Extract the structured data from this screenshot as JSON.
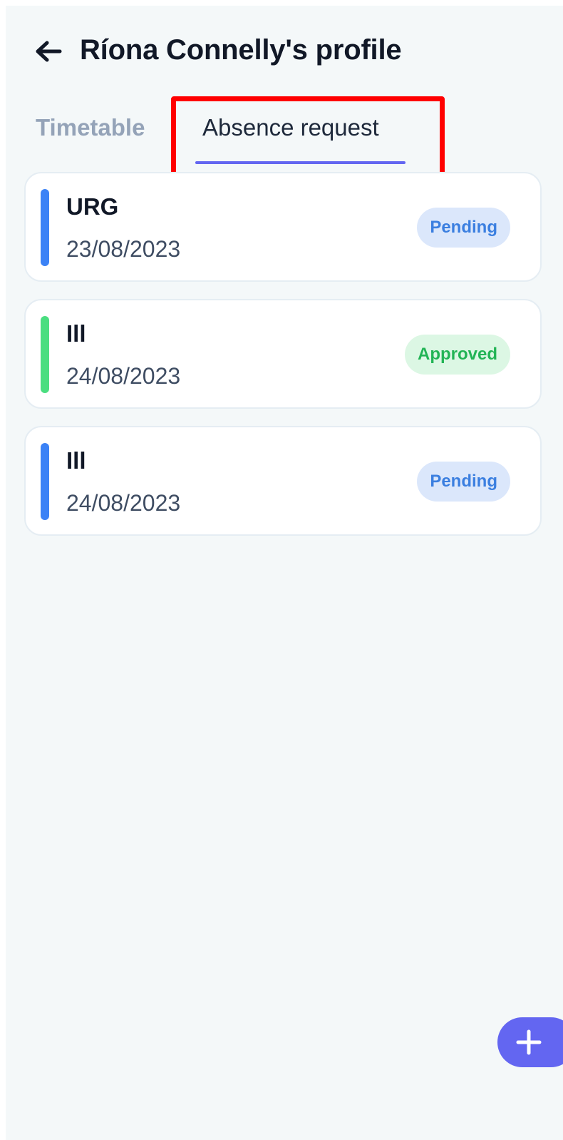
{
  "header": {
    "title": "Ríona Connelly's profile",
    "back_icon": "arrow-left-icon"
  },
  "tabs": [
    {
      "label": "Timetable",
      "active": false
    },
    {
      "label": "Absence request",
      "active": true
    }
  ],
  "colors": {
    "accent": "#6366f1",
    "highlight": "#ff0000",
    "pending_bar": "#3b82f6",
    "pending_badge_bg": "#dbe7fb",
    "pending_badge_text": "#3b7fe0",
    "approved_bar": "#4ade80",
    "approved_badge_bg": "#dcf7e4",
    "approved_badge_text": "#22b455"
  },
  "requests": [
    {
      "title": "URG",
      "date": "23/08/2023",
      "status": "Pending"
    },
    {
      "title": "Ill",
      "date": "24/08/2023",
      "status": "Approved"
    },
    {
      "title": "Ill",
      "date": "24/08/2023",
      "status": "Pending"
    }
  ],
  "fab": {
    "icon": "plus-icon"
  }
}
